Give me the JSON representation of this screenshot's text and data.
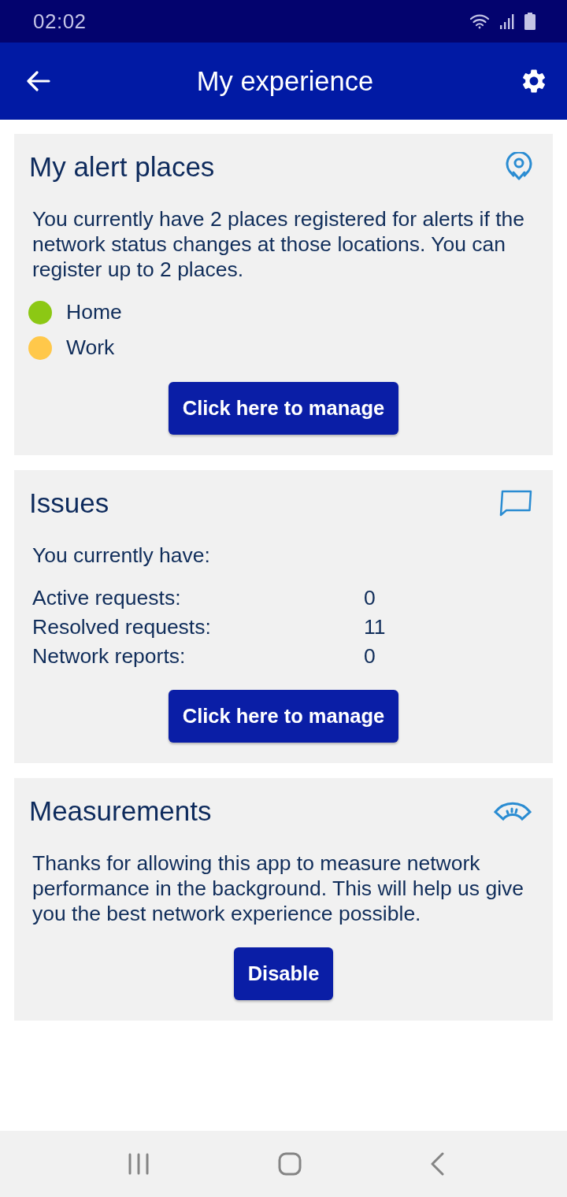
{
  "status_bar": {
    "time": "02:02"
  },
  "app_bar": {
    "title": "My experience"
  },
  "cards": [
    {
      "kind": "places",
      "title": "My alert places",
      "text": "You currently have 2 places registered for alerts if the network status changes at those locations. You can register up to 2 places.",
      "places": [
        {
          "name": "Home",
          "color": "#8cc814"
        },
        {
          "name": "Work",
          "color": "#ffc84a"
        }
      ],
      "button": "Click here to manage"
    },
    {
      "kind": "issues",
      "title": "Issues",
      "intro": "You currently have:",
      "stats": [
        {
          "label": "Active requests:",
          "value": "0"
        },
        {
          "label": "Resolved requests:",
          "value": "11"
        },
        {
          "label": "Network reports:",
          "value": "0"
        }
      ],
      "button": "Click here to manage"
    },
    {
      "kind": "measurements",
      "title": "Measurements",
      "text": "Thanks for allowing this app to measure network performance in the background. This will help us give you the best network experience possible.",
      "button": "Disable"
    }
  ]
}
